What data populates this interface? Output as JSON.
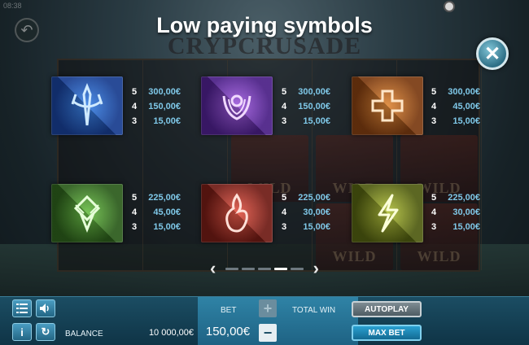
{
  "screen": {
    "title": "Low paying symbols",
    "clock": "08:38",
    "background_logo": "CRYPCRUSADE",
    "wild_label": "WILD"
  },
  "symbols": [
    {
      "name": "blue-sword-symbol",
      "icon": "sword-icon",
      "color": "#1f56b8",
      "pays": [
        {
          "count": "5",
          "amount": "300,00€"
        },
        {
          "count": "4",
          "amount": "150,00€"
        },
        {
          "count": "3",
          "amount": "15,00€"
        }
      ]
    },
    {
      "name": "purple-eye-symbol",
      "icon": "eye-wings-icon",
      "color": "#6b2fa8",
      "pays": [
        {
          "count": "5",
          "amount": "300,00€"
        },
        {
          "count": "4",
          "amount": "150,00€"
        },
        {
          "count": "3",
          "amount": "15,00€"
        }
      ]
    },
    {
      "name": "orange-cross-symbol",
      "icon": "cross-icon",
      "color": "#b8621c",
      "pays": [
        {
          "count": "5",
          "amount": "300,00€"
        },
        {
          "count": "4",
          "amount": "45,00€"
        },
        {
          "count": "3",
          "amount": "15,00€"
        }
      ]
    },
    {
      "name": "green-knot-symbol",
      "icon": "knot-icon",
      "color": "#3f8a2a",
      "pays": [
        {
          "count": "5",
          "amount": "225,00€"
        },
        {
          "count": "4",
          "amount": "45,00€"
        },
        {
          "count": "3",
          "amount": "15,00€"
        }
      ]
    },
    {
      "name": "red-flame-symbol",
      "icon": "flame-icon",
      "color": "#b8352a",
      "pays": [
        {
          "count": "5",
          "amount": "225,00€"
        },
        {
          "count": "4",
          "amount": "30,00€"
        },
        {
          "count": "3",
          "amount": "15,00€"
        }
      ]
    },
    {
      "name": "yellow-lightning-symbol",
      "icon": "lightning-icon",
      "color": "#7f8a1c",
      "pays": [
        {
          "count": "5",
          "amount": "225,00€"
        },
        {
          "count": "4",
          "amount": "30,00€"
        },
        {
          "count": "3",
          "amount": "15,00€"
        }
      ]
    }
  ],
  "pager": {
    "pages": 5,
    "current_page": 4
  },
  "bottom_bar": {
    "balance_label": "BALANCE",
    "balance_value": "10 000,00€",
    "bet_label": "BET",
    "bet_value": "150,00€",
    "total_win_label": "TOTAL WIN",
    "autoplay_label": "AUTOPLAY",
    "max_bet_label": "MAX BET",
    "plus_glyph": "+",
    "minus_glyph": "−"
  },
  "colors": {
    "accent": "#2f83a6",
    "payout_value": "#7fc8e8"
  }
}
